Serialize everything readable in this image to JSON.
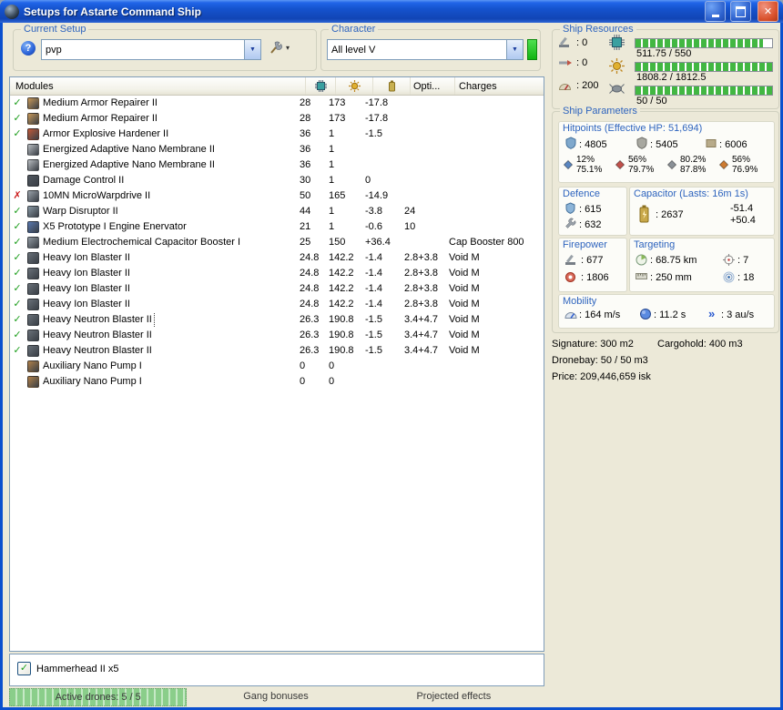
{
  "window": {
    "title": "Setups for Astarte Command Ship"
  },
  "setup": {
    "label": "Current Setup",
    "value": "pvp"
  },
  "character": {
    "label": "Character",
    "value": "All level V"
  },
  "resources": {
    "label": "Ship Resources",
    "turrets": ": 0",
    "launchers": ": 0",
    "calibration": ": 200",
    "cpu": {
      "text": "511.75 / 550",
      "pct": 93
    },
    "powergrid": {
      "text": "1808.2 / 1812.5",
      "pct": 99.8
    },
    "dronebay": {
      "text": "50 / 50",
      "pct": 100
    }
  },
  "parameters": {
    "label": "Ship Parameters",
    "hitpoints": {
      "label": "Hitpoints (Effective HP: 51,694)",
      "shield": ": 4805",
      "armor": ": 5405",
      "hull": ": 6006",
      "resists": [
        {
          "shield": "12%",
          "armor": "75.1%",
          "color": "#5a86c0"
        },
        {
          "shield": "56%",
          "armor": "79.7%",
          "color": "#c0504a"
        },
        {
          "shield": "80.2%",
          "armor": "87.8%",
          "color": "#8a9096"
        },
        {
          "shield": "56%",
          "armor": "76.9%",
          "color": "#cc7a30"
        }
      ]
    },
    "defence": {
      "label": "Defence",
      "shield_recharge": ": 615",
      "armor_repair": ": 632"
    },
    "capacitor": {
      "label": "Capacitor (Lasts: 16m 1s)",
      "amount": ": 2637",
      "drain": "-51.4",
      "recharge": "+50.4"
    },
    "firepower": {
      "label": "Firepower",
      "volley": ": 677",
      "dps": ": 1806"
    },
    "targeting": {
      "label": "Targeting",
      "range": ": 68.75 km",
      "max_targets": ": 7",
      "resolution": ": 250 mm",
      "sensor_strength": ": 18"
    },
    "mobility": {
      "label": "Mobility",
      "speed": ": 164 m/s",
      "align_time": ": 11.2 s",
      "warp_speed": ": 3 au/s"
    }
  },
  "stats": {
    "signature": "Signature: 300 m2",
    "cargohold": "Cargohold: 400 m3",
    "dronebay": "Dronebay: 50 / 50 m3",
    "price": "Price: 209,446,659 isk"
  },
  "modules_table": {
    "header": {
      "modules": "Modules",
      "opti": "Opti...",
      "charges": "Charges"
    },
    "rows": [
      {
        "state": "active",
        "name": "Medium Armor Repairer II",
        "cpu": "28",
        "pg": "173",
        "cap": "-17.8",
        "opti": "",
        "charge": "",
        "icon": "#c89858"
      },
      {
        "state": "active",
        "name": "Medium Armor Repairer II",
        "cpu": "28",
        "pg": "173",
        "cap": "-17.8",
        "opti": "",
        "charge": "",
        "icon": "#c89858"
      },
      {
        "state": "active",
        "name": "Armor Explosive Hardener II",
        "cpu": "36",
        "pg": "1",
        "cap": "-1.5",
        "opti": "",
        "charge": "",
        "icon": "#c05838"
      },
      {
        "state": "online",
        "name": "Energized Adaptive Nano Membrane II",
        "cpu": "36",
        "pg": "1",
        "cap": "",
        "opti": "",
        "charge": "",
        "icon": "#b8bcc0"
      },
      {
        "state": "online",
        "name": "Energized Adaptive Nano Membrane II",
        "cpu": "36",
        "pg": "1",
        "cap": "",
        "opti": "",
        "charge": "",
        "icon": "#b8bcc0"
      },
      {
        "state": "online",
        "name": "Damage Control II",
        "cpu": "30",
        "pg": "1",
        "cap": "0",
        "opti": "",
        "charge": "",
        "icon": "#50565e"
      },
      {
        "state": "offline",
        "name": "10MN MicroWarpdrive II",
        "cpu": "50",
        "pg": "165",
        "cap": "-14.9",
        "opti": "",
        "charge": "",
        "icon": "#9aa2aa"
      },
      {
        "state": "active",
        "name": "Warp Disruptor II",
        "cpu": "44",
        "pg": "1",
        "cap": "-3.8",
        "opti": "24",
        "charge": "",
        "icon": "#8898a4"
      },
      {
        "state": "active",
        "name": "X5 Prototype I Engine Enervator",
        "cpu": "21",
        "pg": "1",
        "cap": "-0.6",
        "opti": "10",
        "charge": "",
        "icon": "#5878b0"
      },
      {
        "state": "active",
        "name": "Medium Electrochemical Capacitor Booster I",
        "cpu": "25",
        "pg": "150",
        "cap": "+36.4",
        "opti": "",
        "charge": "Cap Booster 800",
        "icon": "#9098a0"
      },
      {
        "state": "active",
        "name": "Heavy Ion Blaster II",
        "cpu": "24.8",
        "pg": "142.2",
        "cap": "-1.4",
        "opti": "2.8+3.8",
        "charge": "Void M",
        "icon": "#687078"
      },
      {
        "state": "active",
        "name": "Heavy Ion Blaster II",
        "cpu": "24.8",
        "pg": "142.2",
        "cap": "-1.4",
        "opti": "2.8+3.8",
        "charge": "Void M",
        "icon": "#687078"
      },
      {
        "state": "active",
        "name": "Heavy Ion Blaster II",
        "cpu": "24.8",
        "pg": "142.2",
        "cap": "-1.4",
        "opti": "2.8+3.8",
        "charge": "Void M",
        "icon": "#687078"
      },
      {
        "state": "active",
        "name": "Heavy Ion Blaster II",
        "cpu": "24.8",
        "pg": "142.2",
        "cap": "-1.4",
        "opti": "2.8+3.8",
        "charge": "Void M",
        "icon": "#687078"
      },
      {
        "state": "active",
        "name": "Heavy Neutron Blaster II",
        "cpu": "26.3",
        "pg": "190.8",
        "cap": "-1.5",
        "opti": "3.4+4.7",
        "charge": "Void M",
        "icon": "#687078",
        "selected": true
      },
      {
        "state": "active",
        "name": "Heavy Neutron Blaster II",
        "cpu": "26.3",
        "pg": "190.8",
        "cap": "-1.5",
        "opti": "3.4+4.7",
        "charge": "Void M",
        "icon": "#687078"
      },
      {
        "state": "active",
        "name": "Heavy Neutron Blaster II",
        "cpu": "26.3",
        "pg": "190.8",
        "cap": "-1.5",
        "opti": "3.4+4.7",
        "charge": "Void M",
        "icon": "#687078"
      },
      {
        "state": "online",
        "name": "Auxiliary Nano Pump I",
        "cpu": "0",
        "pg": "0",
        "cap": "",
        "opti": "",
        "charge": "",
        "icon": "#b08048"
      },
      {
        "state": "online",
        "name": "Auxiliary Nano Pump I",
        "cpu": "0",
        "pg": "0",
        "cap": "",
        "opti": "",
        "charge": "",
        "icon": "#b08048"
      }
    ]
  },
  "drone_bay": {
    "items": [
      {
        "checked": true,
        "label": "Hammerhead II x5"
      }
    ]
  },
  "bottom_tabs": {
    "active_drones": "Active drones: 5 / 5",
    "gang_bonuses": "Gang bonuses",
    "projected_effects": "Projected effects"
  },
  "colors": {
    "progress_green": "#42B742",
    "active_check": "#1D9E1D",
    "offline_cross": "#CC2020",
    "group_label_blue": "#2E64BE"
  }
}
